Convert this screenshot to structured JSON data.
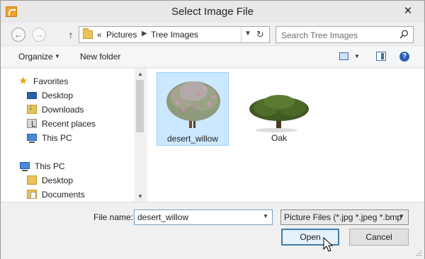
{
  "window": {
    "title": "Select Image File"
  },
  "address": {
    "prefix": "«",
    "parts": [
      "Pictures",
      "Tree Images"
    ]
  },
  "search": {
    "placeholder": "Search Tree Images"
  },
  "toolbar": {
    "organize": "Organize",
    "new_folder": "New folder",
    "help": "?"
  },
  "nav": {
    "items": [
      {
        "label": "Favorites",
        "icon": "star-icon"
      },
      {
        "label": "Desktop",
        "icon": "desktop-icon"
      },
      {
        "label": "Downloads",
        "icon": "downloads-folder-icon"
      },
      {
        "label": "Recent places",
        "icon": "recent-places-icon"
      },
      {
        "label": "This PC",
        "icon": "computer-icon"
      },
      {
        "label": "This PC",
        "icon": "computer-icon"
      },
      {
        "label": "Desktop",
        "icon": "folder-icon"
      },
      {
        "label": "Documents",
        "icon": "documents-folder-icon"
      }
    ]
  },
  "files": [
    {
      "name": "desert_willow",
      "selected": true
    },
    {
      "name": "Oak",
      "selected": false
    }
  ],
  "bottom": {
    "file_name_label": "File name:",
    "file_name_value": "desert_willow",
    "filter": "Picture Files (*.jpg *.jpeg *.bmp",
    "open_label": "Open",
    "cancel_label": "Cancel"
  },
  "colors": {
    "selection": "#cce8ff",
    "accent": "#3c7fb1",
    "folder": "#e9c25a"
  }
}
